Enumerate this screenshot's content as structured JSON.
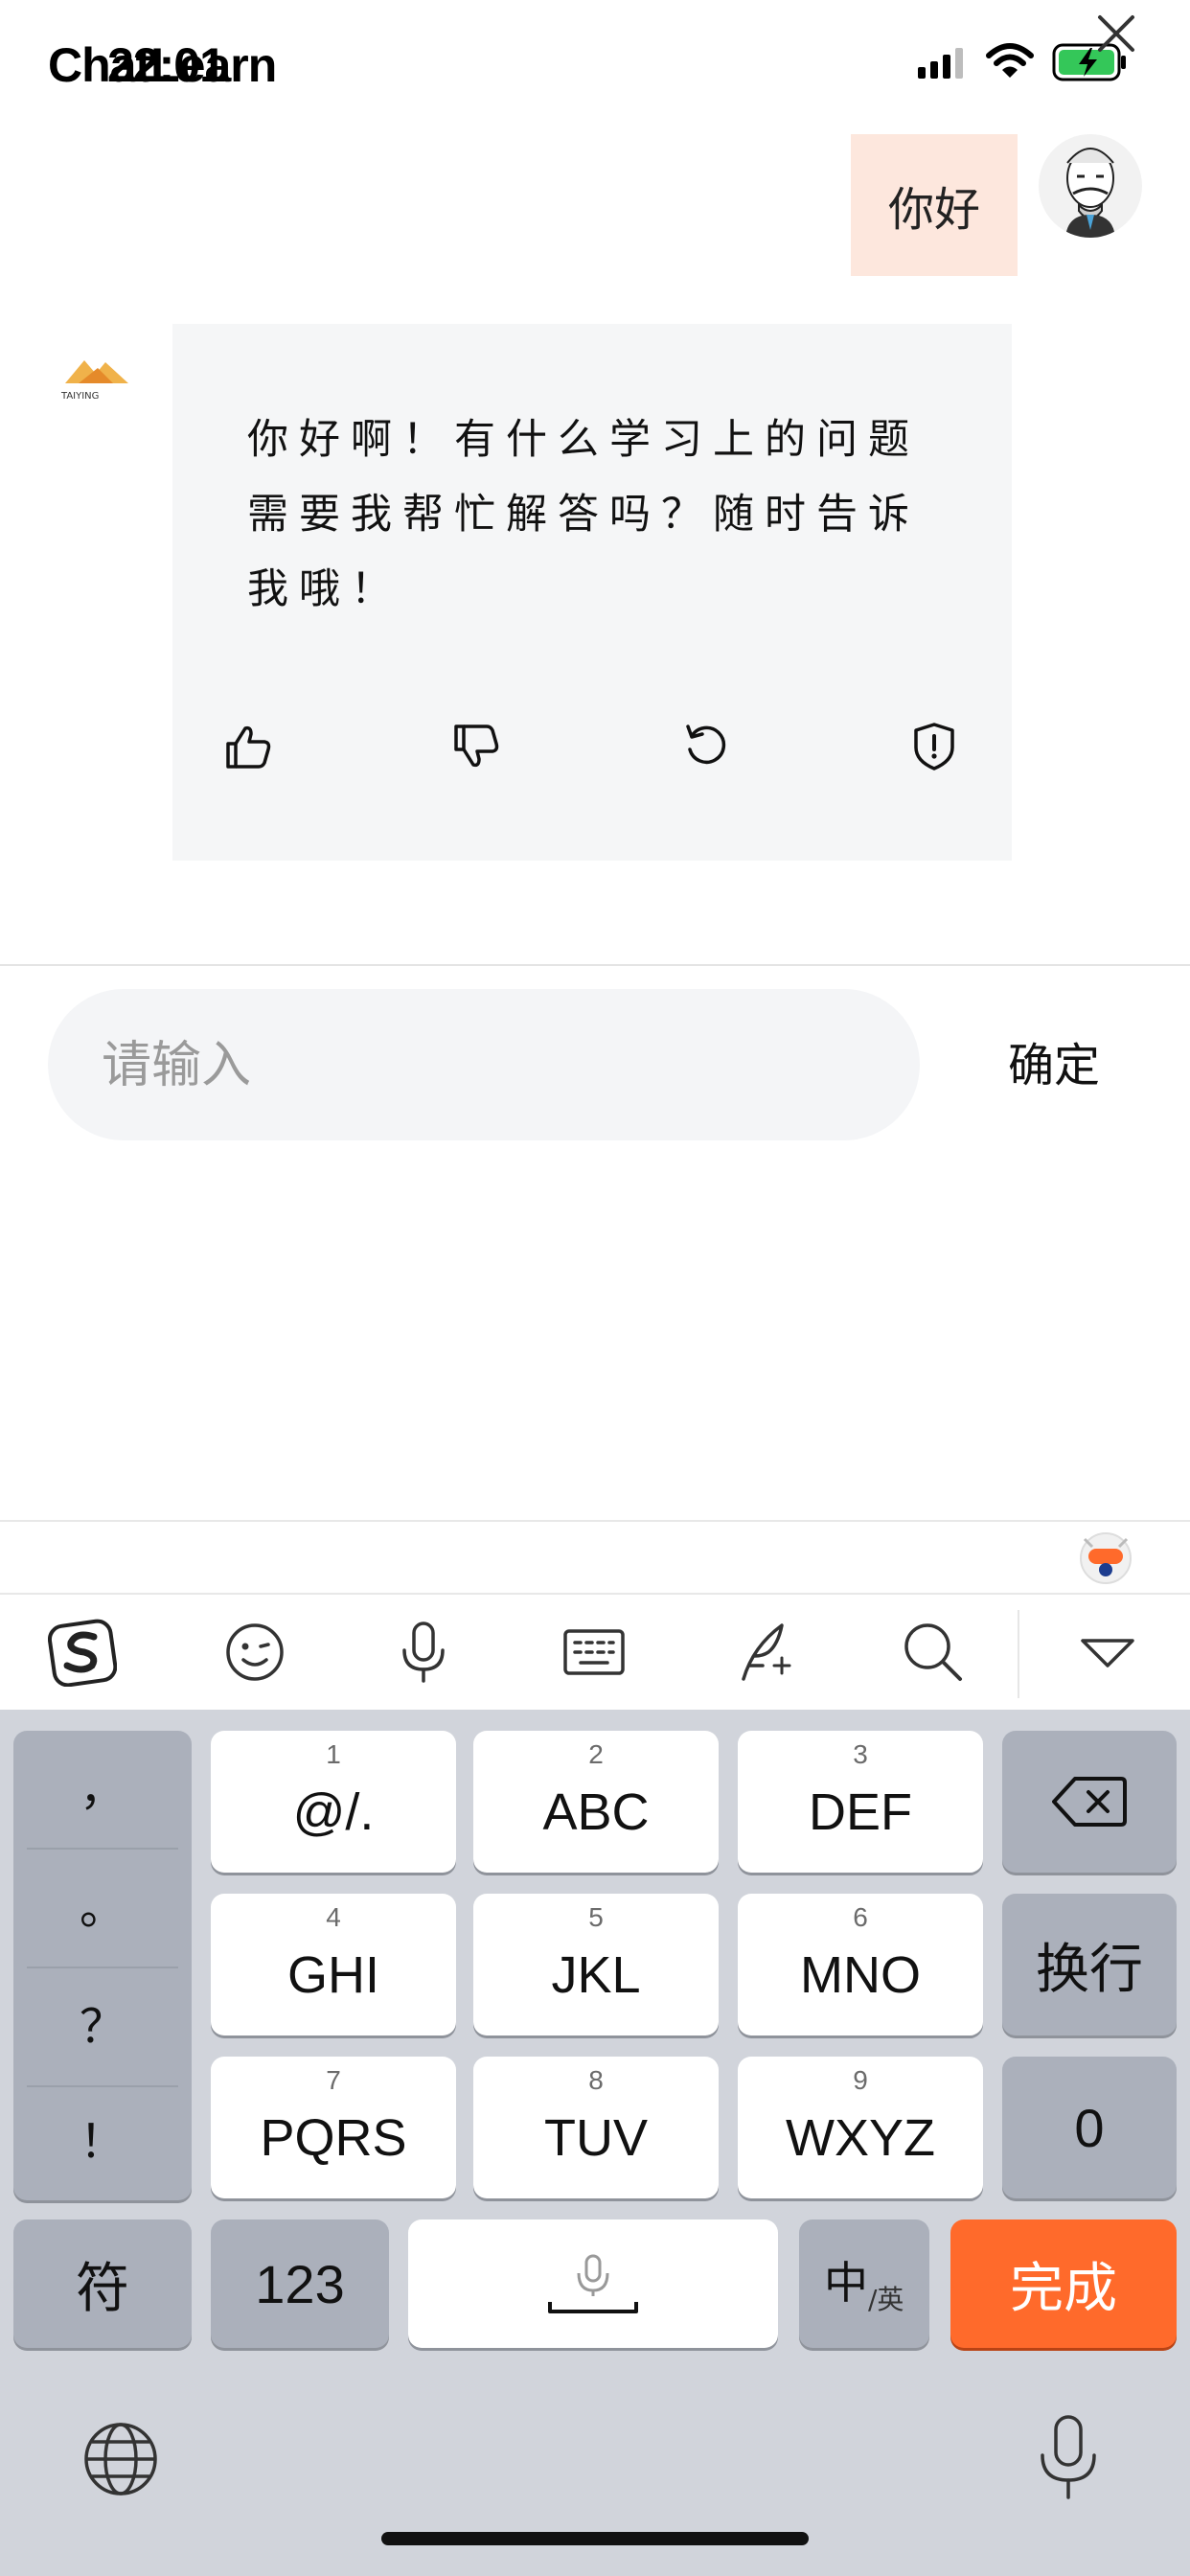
{
  "status_bar": {
    "app_title": "ChatLearn",
    "time": "22:01"
  },
  "chat": {
    "user_message": "你好",
    "bot_logo_text": "TAIYING",
    "bot_message": "你好啊！有什么学习上的问题需要我帮忙解答吗？随时告诉我哦！",
    "actions": [
      "like",
      "dislike",
      "regenerate",
      "report"
    ]
  },
  "input": {
    "placeholder": "请输入",
    "value": "",
    "confirm_label": "确定"
  },
  "keyboard": {
    "punctuation": [
      "，",
      "。",
      "？",
      "！"
    ],
    "keys": [
      {
        "num": "1",
        "letters": "@/."
      },
      {
        "num": "2",
        "letters": "ABC"
      },
      {
        "num": "3",
        "letters": "DEF"
      },
      {
        "num": "4",
        "letters": "GHI"
      },
      {
        "num": "5",
        "letters": "JKL"
      },
      {
        "num": "6",
        "letters": "MNO"
      },
      {
        "num": "7",
        "letters": "PQRS"
      },
      {
        "num": "8",
        "letters": "TUV"
      },
      {
        "num": "9",
        "letters": "WXYZ"
      }
    ],
    "newline_label": "换行",
    "zero_label": "0",
    "symbols_label": "符",
    "numbers_label": "123",
    "lang_main": "中",
    "lang_sub": "/英",
    "done_label": "完成",
    "accent_color": "#ff6a2b"
  }
}
